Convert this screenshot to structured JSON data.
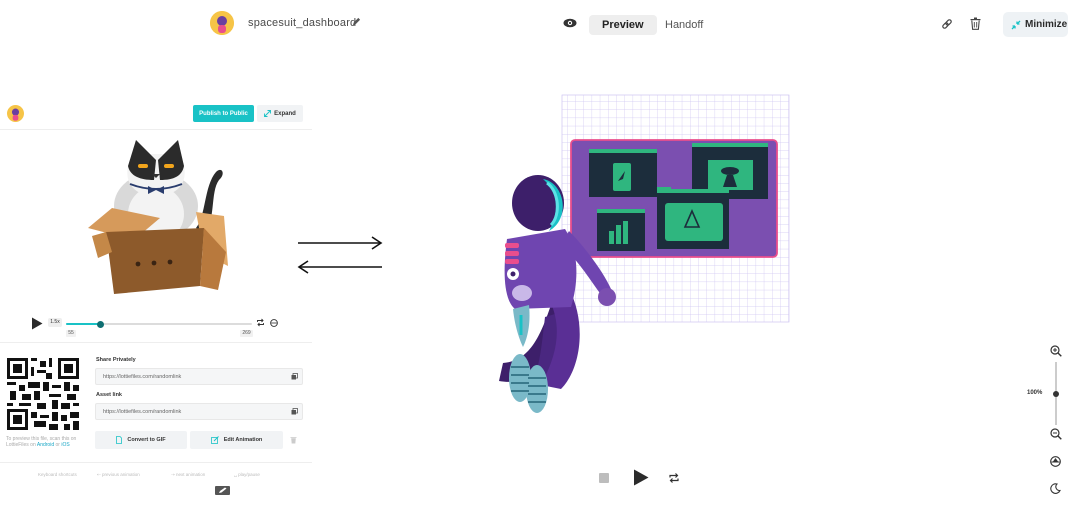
{
  "header": {
    "project_name": "spacesuit_dashboard",
    "tabs": [
      {
        "label": "Preview",
        "active": true
      },
      {
        "label": "Handoff",
        "active": false
      }
    ],
    "minimize_label": "Minimize"
  },
  "left_panel": {
    "publish_label": "Publish to Public",
    "expand_label": "Expand",
    "player": {
      "speed": "1.5x",
      "start_frame": "55",
      "end_frame": "269",
      "progress": 0.18
    },
    "share": {
      "share_label": "Share Privately",
      "share_url": "https://lottiefiles.com/randomlink",
      "asset_label": "Asset link",
      "asset_url": "https://lottiefiles.com/randomlink",
      "convert_label": "Convert to GIF",
      "edit_label": "Edit Animation"
    },
    "preview_hint": {
      "line1": "To preview this file, scan this on",
      "line2_prefix": "LottieFiles on ",
      "android": "Android",
      "or": " or ",
      "ios": "iOS"
    },
    "shortcuts": [
      {
        "label": "Keyboard shortcuts"
      },
      {
        "label": "previous animation"
      },
      {
        "label": "next animation"
      },
      {
        "label": "play/pause"
      }
    ]
  },
  "zoom": {
    "level": "100%"
  },
  "colors": {
    "accent": "#19c2c6",
    "purple": "#7b4fb0",
    "green": "#2fb67f",
    "pink": "#e94e8d"
  }
}
